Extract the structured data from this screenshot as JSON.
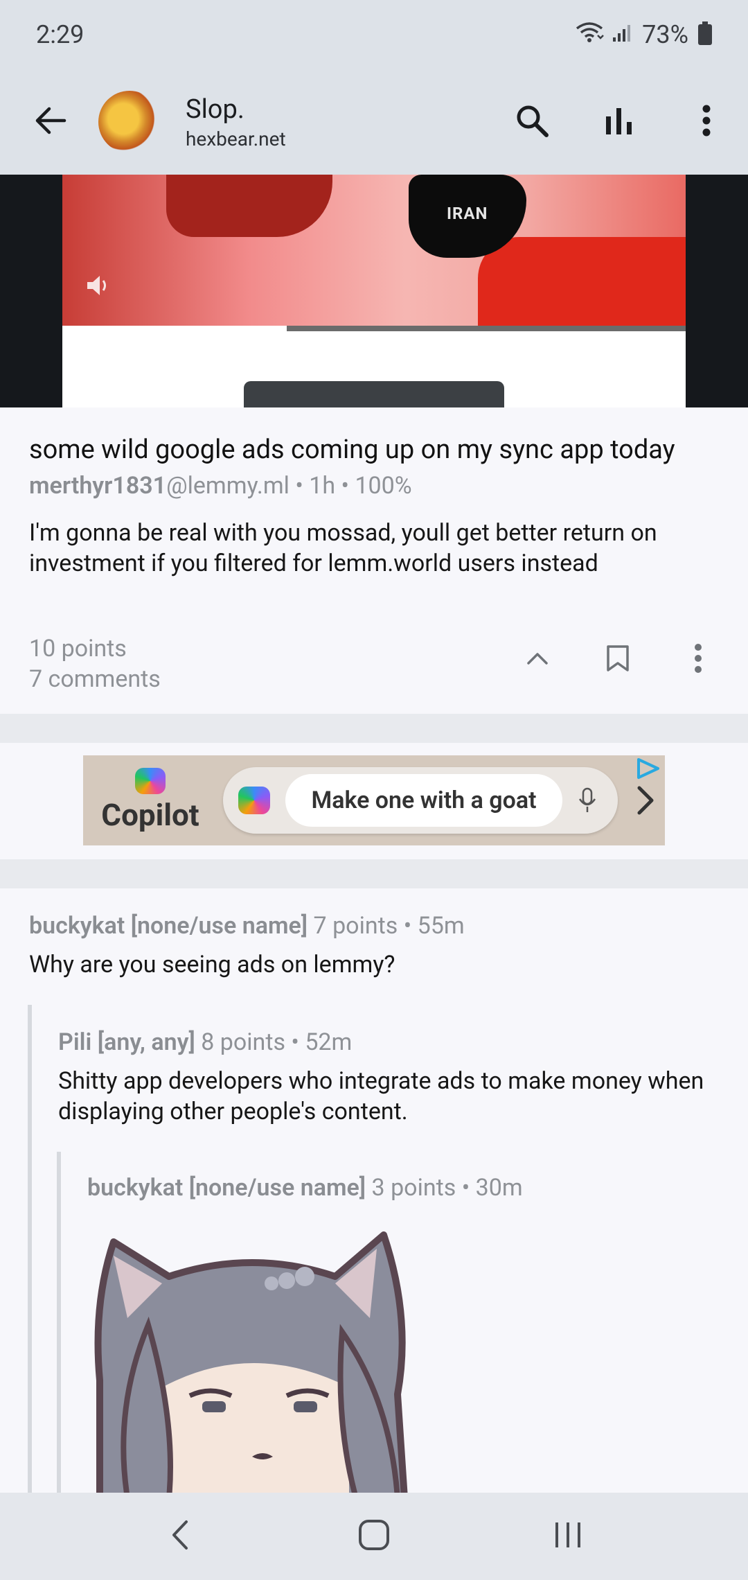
{
  "status_bar": {
    "time": "2:29",
    "battery": "73%",
    "icons": [
      "wifi-icon",
      "signal-icon",
      "battery-icon"
    ]
  },
  "app_bar": {
    "title": "Slop.",
    "subtitle": "hexbear.net",
    "icons": [
      "back-arrow-icon",
      "search-icon",
      "bar-chart-icon",
      "more-vert-icon"
    ]
  },
  "media": {
    "map_label": "IRAN",
    "progress": 0.36
  },
  "post": {
    "title": "some wild google ads coming up on my sync app today",
    "author": "merthyr1831",
    "instance": "@lemmy.ml",
    "meta_rest": " • 1h • 100%",
    "body": "I'm gonna be real with you mossad, youll get better return on investment if you filtered for lemm.world users instead",
    "points": "10 points",
    "comments": "7 comments",
    "action_icons": [
      "upvote-icon",
      "bookmark-icon",
      "more-vert-icon"
    ]
  },
  "ad": {
    "brand": "Copilot",
    "prompt": "Make one with a goat",
    "icons": [
      "copilot-logo-icon",
      "mic-icon",
      "chevron-right-icon",
      "ad-choices-icon"
    ],
    "colors": {
      "background": "#d5c9bd",
      "pill": "#ebe7e3"
    }
  },
  "comments": [
    {
      "author": "buckykat [none/use name]",
      "meta": " 7 points • 55m",
      "body": "Why are you seeing ads on lemmy?"
    },
    {
      "author": "Pili [any, any]",
      "meta": " 8 points • 52m",
      "body": "Shitty app developers who integrate ads to make money when displaying other people's content."
    },
    {
      "author": "buckykat [none/use name]",
      "meta": " 3 points • 30m",
      "body": ""
    }
  ],
  "nav_bar": {
    "icons": [
      "nav-back-icon",
      "nav-home-icon",
      "nav-recents-icon"
    ]
  }
}
